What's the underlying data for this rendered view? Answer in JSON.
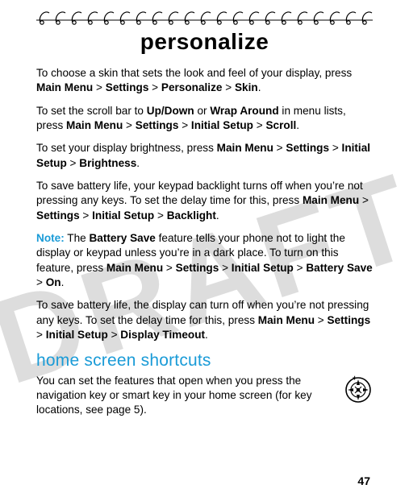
{
  "watermark": "DRAFT",
  "title": "personalize",
  "paragraphs": {
    "p1a": "To choose a skin that sets the look and feel of your display, press ",
    "p1_path": [
      "Main Menu",
      "Settings",
      "Personalize",
      "Skin"
    ],
    "p2a": "To set the scroll bar to ",
    "p2_opt1": "Up/Down",
    "p2_mid": " or ",
    "p2_opt2": "Wrap Around",
    "p2b": " in menu lists, press ",
    "p2_path": [
      "Main Menu",
      "Settings",
      "Initial Setup",
      "Scroll"
    ],
    "p3a": "To set your display brightness, press ",
    "p3_path": [
      "Main Menu",
      "Settings",
      "Initial Setup",
      "Brightness"
    ],
    "p4a": "To save battery life, your keypad backlight turns off when you’re not pressing any keys. To set the delay time for this, press ",
    "p4_path": [
      "Main Menu",
      "Settings",
      "Initial Setup",
      "Backlight"
    ],
    "note_label": "Note:",
    "p5a": " The ",
    "p5_feat": "Battery Save",
    "p5b": " feature tells your phone not to light the display or keypad unless you’re in a dark place. To turn on this feature, press ",
    "p5_path": [
      "Main Menu",
      "Settings",
      "Initial Setup",
      "Battery Save",
      "On"
    ],
    "p6a": "To save battery life, the display can turn off when you’re not pressing any keys. To set the delay time for this, press ",
    "p6_path": [
      "Main Menu",
      "Settings",
      "Initial Setup",
      "Display Timeout"
    ]
  },
  "section_heading": "home screen shortcuts",
  "shortcut_text": "You can set the features that open when you press the navigation key or smart key in your home screen (for key locations, see page 5).",
  "gt": ">",
  "period": ".",
  "page_number": "47"
}
